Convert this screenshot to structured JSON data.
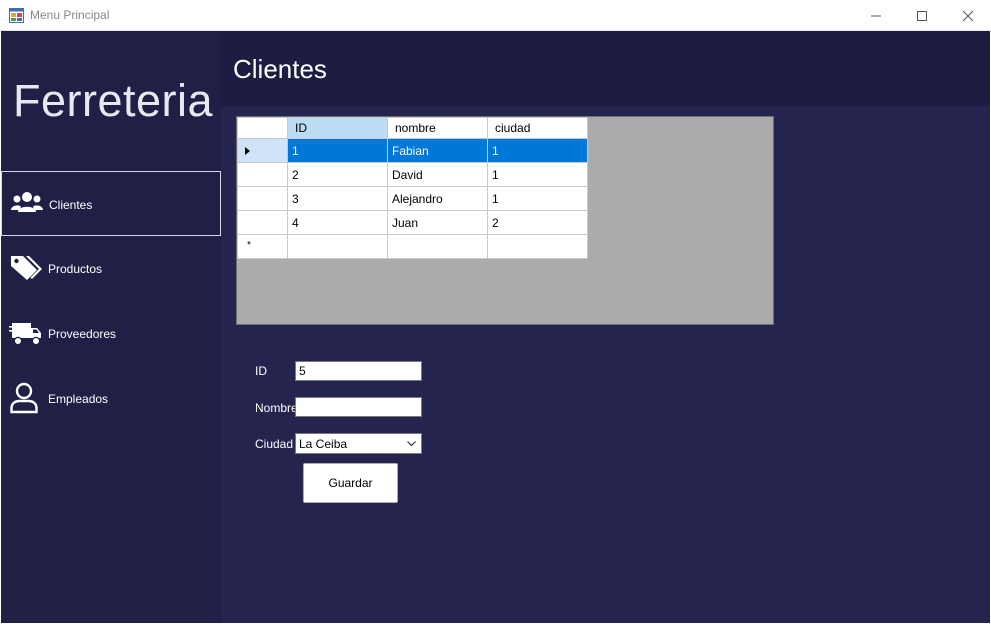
{
  "window": {
    "title": "Menu Principal",
    "icon": "app-form-icon"
  },
  "sidebar": {
    "brand": "Ferreteria",
    "items": [
      {
        "label": "Clientes",
        "icon": "users-icon",
        "active": true
      },
      {
        "label": "Productos",
        "icon": "tags-icon",
        "active": false
      },
      {
        "label": "Proveedores",
        "icon": "truck-icon",
        "active": false
      },
      {
        "label": "Empleados",
        "icon": "user-icon",
        "active": false
      }
    ]
  },
  "header": {
    "title": "Clientes"
  },
  "grid": {
    "columns": [
      "ID",
      "nombre",
      "ciudad"
    ],
    "rows": [
      [
        "1",
        "Fabian",
        "1"
      ],
      [
        "2",
        "David",
        "1"
      ],
      [
        "3",
        "Alejandro",
        "1"
      ],
      [
        "4",
        "Juan",
        "2"
      ]
    ],
    "new_row_marker": "*",
    "selected_row": 0
  },
  "form": {
    "id_label": "ID",
    "id_value": "5",
    "nombre_label": "Nombre",
    "nombre_value": "",
    "ciudad_label": "Ciudad",
    "ciudad_value": "La Ceiba",
    "save_label": "Guardar"
  },
  "colors": {
    "sidebar": "#202046",
    "header": "#1d1d44",
    "body": "#24244e",
    "selection": "#0078d7"
  }
}
